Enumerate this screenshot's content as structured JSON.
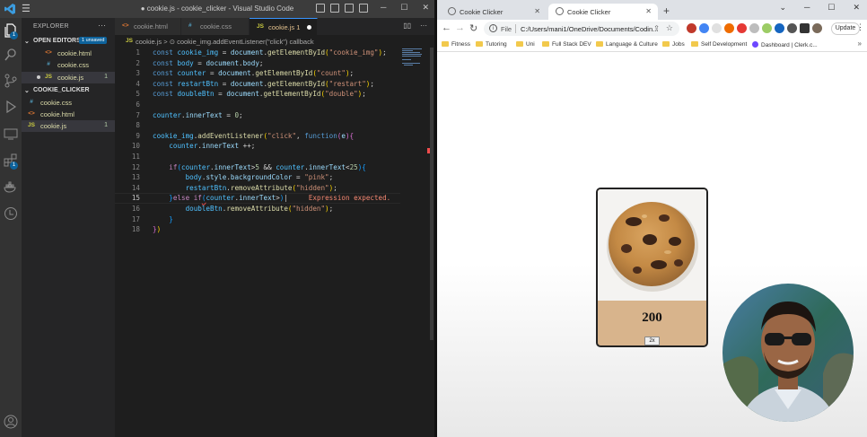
{
  "vscode": {
    "window_title": "● cookie.js - cookie_clicker - Visual Studio Code",
    "explorer_title": "EXPLORER",
    "open_editors_label": "OPEN EDITORS",
    "unsaved_badge": "1 unsaved",
    "open_editors": [
      {
        "icon": "<>",
        "name": "cookie.html"
      },
      {
        "icon": "#",
        "name": "cookie.css"
      },
      {
        "icon": "JS",
        "name": "cookie.js",
        "problems": "1",
        "modified": true
      }
    ],
    "folder_label": "COOKIE_CLICKER",
    "folder_files": [
      {
        "icon": "#",
        "name": "cookie.css"
      },
      {
        "icon": "<>",
        "name": "cookie.html"
      },
      {
        "icon": "JS",
        "name": "cookie.js",
        "problems": "1"
      }
    ],
    "tabs": [
      {
        "icon": "<>",
        "label": "cookie.html"
      },
      {
        "icon": "#",
        "label": "cookie.css"
      },
      {
        "icon": "JS",
        "label": "cookie.js 1"
      }
    ],
    "breadcrumb": "cookie.js > ⊙ cookie_img.addEventListener(\"click\") callback",
    "activity_badges": {
      "explorer": "1",
      "extensions": "1"
    },
    "current_line": 15,
    "error_message": "Expression expected."
  },
  "chrome": {
    "tabs": [
      "Cookie Clicker",
      "Cookie Clicker"
    ],
    "url_scheme_label": "File",
    "url": "C:/Users/mani1/OneDrive/Documents/Codin...",
    "update_label": "Update",
    "bookmarks": [
      "Fitness",
      "Tutoring",
      "Uni",
      "Full Stack DEV",
      "Language & Culture",
      "Jobs",
      "Self Development",
      "Dashboard | Clerk.c..."
    ]
  },
  "page": {
    "counter": "200",
    "double_button": "2x"
  }
}
